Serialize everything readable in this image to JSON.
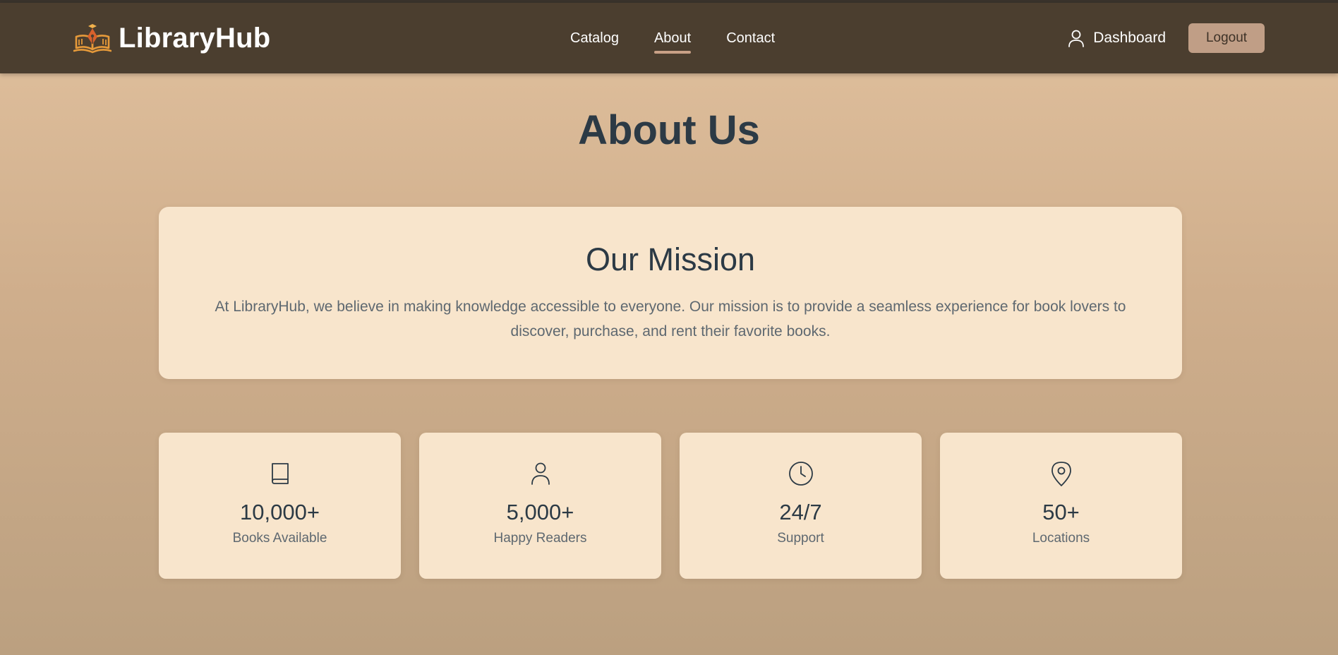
{
  "colors": {
    "navbar": "#4b3e2f",
    "accent": "#c8a086",
    "logout_button": "#c09e86",
    "card": "#f8e5cc",
    "heading": "#2c3a45",
    "body_text": "#5e6870"
  },
  "header": {
    "logo_icon": "open-book-pen-icon",
    "brand": "LibraryHub",
    "nav": [
      {
        "label": "Catalog",
        "active": false
      },
      {
        "label": "About",
        "active": true
      },
      {
        "label": "Contact",
        "active": false
      }
    ],
    "dashboard": {
      "icon": "user-icon",
      "label": "Dashboard"
    },
    "logout_label": "Logout"
  },
  "main": {
    "title": "About Us",
    "mission": {
      "title": "Our Mission",
      "text": "At LibraryHub, we believe in making knowledge accessible to everyone. Our mission is to provide a seamless experience for book lovers to discover, purchase, and rent their favorite books."
    },
    "stats": [
      {
        "icon": "book-icon",
        "value": "10,000+",
        "label": "Books Available"
      },
      {
        "icon": "user-icon",
        "value": "5,000+",
        "label": "Happy Readers"
      },
      {
        "icon": "clock-icon",
        "value": "24/7",
        "label": "Support"
      },
      {
        "icon": "map-pin-icon",
        "value": "50+",
        "label": "Locations"
      }
    ]
  }
}
